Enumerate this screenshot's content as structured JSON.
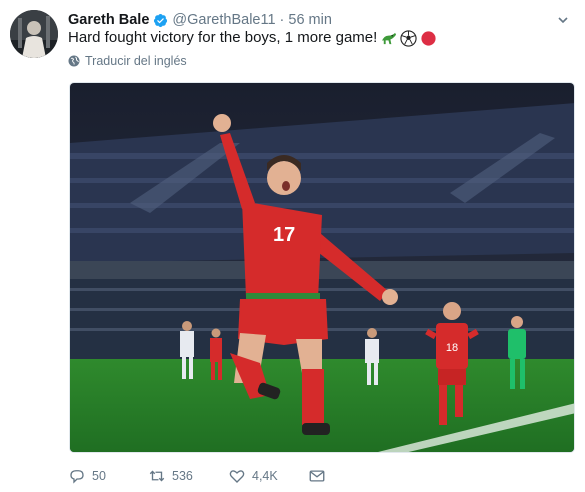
{
  "tweet": {
    "author_name": "Gareth Bale",
    "author_handle": "@GarethBale11",
    "separator": "·",
    "time": "56 min",
    "text": "Hard fought victory for the boys, 1 more game!",
    "emojis": [
      "crocodile-emoji",
      "soccer-ball-emoji",
      "red-circle-emoji"
    ],
    "translate_label": "Traducir del inglés",
    "shirt_number": "17",
    "other_shirt_number": "18"
  },
  "actions": {
    "reply_count": "50",
    "retweet_count": "536",
    "like_count": "4,4K"
  },
  "icons": {
    "verified": "verified-badge-icon",
    "caret": "chevron-down-icon",
    "globe": "globe-icon",
    "reply": "reply-icon",
    "retweet": "retweet-icon",
    "like": "heart-icon",
    "dm": "envelope-icon"
  },
  "colors": {
    "accent": "#1da1f2",
    "secondary_text": "#657786",
    "jersey_red": "#d52b2b"
  }
}
